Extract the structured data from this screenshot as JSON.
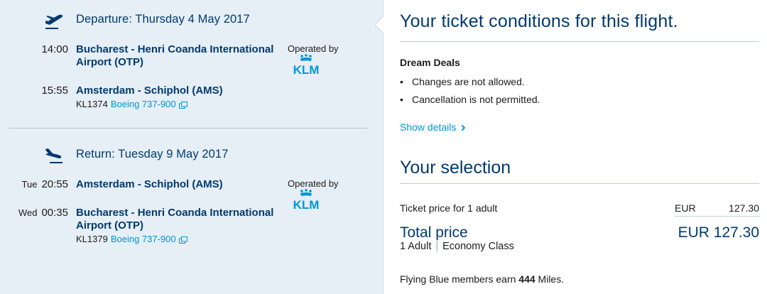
{
  "departure": {
    "title": "Departure: Thursday 4 May 2017",
    "from_time": "14:00",
    "from_airport": "Bucharest - Henri Coanda International Airport (OTP)",
    "to_time": "15:55",
    "to_airport": "Amsterdam - Schiphol (AMS)",
    "flight_number": "KL1374",
    "aircraft": "Boeing 737-900",
    "operated_by": "Operated by",
    "carrier": "KLM"
  },
  "return": {
    "title": "Return: Tuesday 9 May 2017",
    "from_day": "Tue",
    "from_time": "20:55",
    "from_airport": "Amsterdam - Schiphol (AMS)",
    "to_day": "Wed",
    "to_time": "00:35",
    "to_airport": "Bucharest - Henri Coanda International Airport (OTP)",
    "flight_number": "KL1379",
    "aircraft": "Boeing 737-900",
    "operated_by": "Operated by",
    "carrier": "KLM"
  },
  "conditions": {
    "title": "Your ticket conditions for this flight.",
    "fare_name": "Dream Deals",
    "rules": [
      "Changes are not allowed.",
      "Cancellation is not permitted."
    ],
    "show_details": "Show details"
  },
  "selection": {
    "title": "Your selection",
    "ticket_label": "Ticket price for 1 adult",
    "ticket_currency": "EUR",
    "ticket_amount": "127.30",
    "total_label": "Total price",
    "total_amount": "EUR 127.30",
    "passengers": "1 Adult",
    "cabin": "Economy Class",
    "miles_prefix": "Flying Blue members earn",
    "miles_value": "444",
    "miles_suffix": "Miles."
  },
  "colors": {
    "brand_dark": "#003a70",
    "link": "#0096d6",
    "panel_bg": "#e6eef6"
  }
}
